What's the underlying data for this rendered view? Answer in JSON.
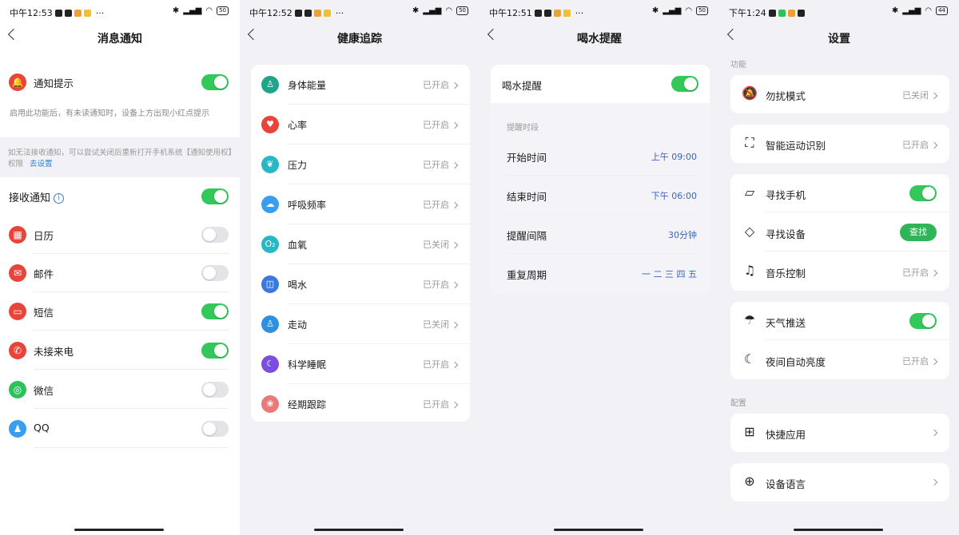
{
  "colors": {
    "green": "#34c759",
    "red": "#e8443a",
    "blue_link": "#2a7de1",
    "panel_bg": "#f2f2f6"
  },
  "p1": {
    "status": {
      "time": "中午12:53",
      "battery": "50"
    },
    "title": "消息通知",
    "notify": {
      "label": "通知提示",
      "icon": "bell-off-icon",
      "on": true
    },
    "desc": "启用此功能后，有未读通知时，设备上方出现小红点提示",
    "hint1": "如无法接收通知，可以尝试关闭后重新打开手机系统【通知使用权】",
    "hint2": "权限",
    "hint_link": "去设置",
    "receive": {
      "label": "接收通知",
      "info_icon": "info-icon",
      "on": true
    },
    "apps": [
      {
        "label": "日历",
        "icon": "calendar-icon",
        "color": "#e8443a",
        "on": false
      },
      {
        "label": "邮件",
        "icon": "mail-icon",
        "color": "#e8443a",
        "on": false
      },
      {
        "label": "短信",
        "icon": "sms-icon",
        "color": "#e8443a",
        "on": true
      },
      {
        "label": "未接来电",
        "icon": "phone-icon",
        "color": "#e8443a",
        "on": true
      },
      {
        "label": "微信",
        "icon": "wechat-icon",
        "color": "#2dc15a",
        "on": false
      },
      {
        "label": "QQ",
        "icon": "qq-icon",
        "color": "#3a9ef0",
        "on": false
      }
    ]
  },
  "p2": {
    "status": {
      "time": "中午12:52",
      "battery": "50"
    },
    "title": "健康追踪",
    "items": [
      {
        "label": "身体能量",
        "value": "已开启",
        "icon": "body-energy-icon",
        "color": "#1fa58a"
      },
      {
        "label": "心率",
        "value": "已开启",
        "icon": "heart-icon",
        "color": "#e8443a"
      },
      {
        "label": "压力",
        "value": "已开启",
        "icon": "stress-icon",
        "color": "#27b7c5"
      },
      {
        "label": "呼吸频率",
        "value": "已开启",
        "icon": "breath-icon",
        "color": "#3a9ef0"
      },
      {
        "label": "血氧",
        "value": "已关闭",
        "icon": "blood-oxygen-icon",
        "color": "#27b7c5"
      },
      {
        "label": "喝水",
        "value": "已开启",
        "icon": "water-icon",
        "color": "#3a78e0"
      },
      {
        "label": "走动",
        "value": "已关闭",
        "icon": "walk-icon",
        "color": "#2f8fe0"
      },
      {
        "label": "科学睡眠",
        "value": "已开启",
        "icon": "sleep-icon",
        "color": "#7a4fe0"
      },
      {
        "label": "经期跟踪",
        "value": "已开启",
        "icon": "period-icon",
        "color": "#e87a7a"
      }
    ]
  },
  "p3": {
    "status": {
      "time": "中午12:51",
      "battery": "50"
    },
    "title": "喝水提醒",
    "main": {
      "label": "喝水提醒",
      "on": true
    },
    "section": "提醒时段",
    "rows": [
      {
        "label": "开始时间",
        "value": "上午 09:00"
      },
      {
        "label": "结束时间",
        "value": "下午 06:00"
      },
      {
        "label": "提醒间隔",
        "value": "30分钟"
      },
      {
        "label": "重复周期",
        "value": "一 二 三 四 五"
      }
    ]
  },
  "p4": {
    "status": {
      "time": "下午1:24",
      "battery": "44"
    },
    "title": "设置",
    "section1": "功能",
    "section2": "配置",
    "dnd": {
      "label": "勿扰模式",
      "value": "已关闭",
      "icon": "bell-off-icon"
    },
    "sport": {
      "label": "智能运动识别",
      "value": "已开启",
      "icon": "sport-detect-icon"
    },
    "find_phone": {
      "label": "寻找手机",
      "icon": "find-phone-icon",
      "on": true
    },
    "find_device": {
      "label": "寻找设备",
      "icon": "find-device-icon",
      "button": "查找"
    },
    "music": {
      "label": "音乐控制",
      "value": "已开启",
      "icon": "music-icon"
    },
    "weather": {
      "label": "天气推送",
      "icon": "weather-icon",
      "on": true
    },
    "night": {
      "label": "夜间自动亮度",
      "value": "已开启",
      "icon": "night-brightness-icon"
    },
    "shortcut": {
      "label": "快捷应用",
      "icon": "shortcut-apps-icon"
    },
    "language": {
      "label": "设备语言",
      "icon": "globe-icon"
    }
  }
}
